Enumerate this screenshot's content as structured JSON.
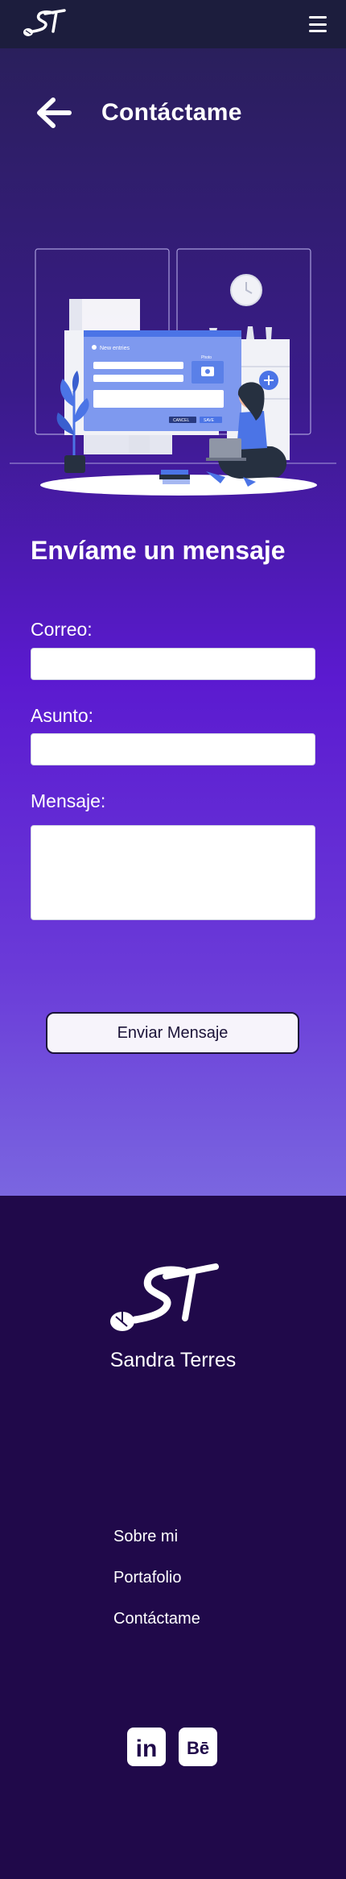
{
  "header": {
    "logo_text": "ST",
    "menu_icon": "hamburger-menu-icon"
  },
  "page": {
    "title": "Contáctame",
    "back_icon": "arrow-left-icon"
  },
  "illustration": {
    "window_title": "New entries",
    "photo_label": "Photo",
    "cancel_label": "CANCEL",
    "save_label": "SAVE"
  },
  "form": {
    "title": "Envíame un mensaje",
    "email_label": "Correo:",
    "email_value": "",
    "subject_label": "Asunto:",
    "subject_value": "",
    "message_label": "Mensaje:",
    "message_value": "",
    "submit_label": "Enviar Mensaje"
  },
  "footer": {
    "logo_text": "ST",
    "name": "Sandra Terres",
    "links": [
      "Sobre mi",
      "Portafolio",
      "Contáctame"
    ],
    "social": [
      {
        "label": "in",
        "icon": "linkedin-icon"
      },
      {
        "label": "Bē",
        "icon": "behance-icon"
      }
    ]
  },
  "colors": {
    "topbar": "#1c1d3d",
    "footer": "#20094a",
    "accent_purple": "#5b1ad0",
    "illustration_blue": "#4b74e6"
  }
}
